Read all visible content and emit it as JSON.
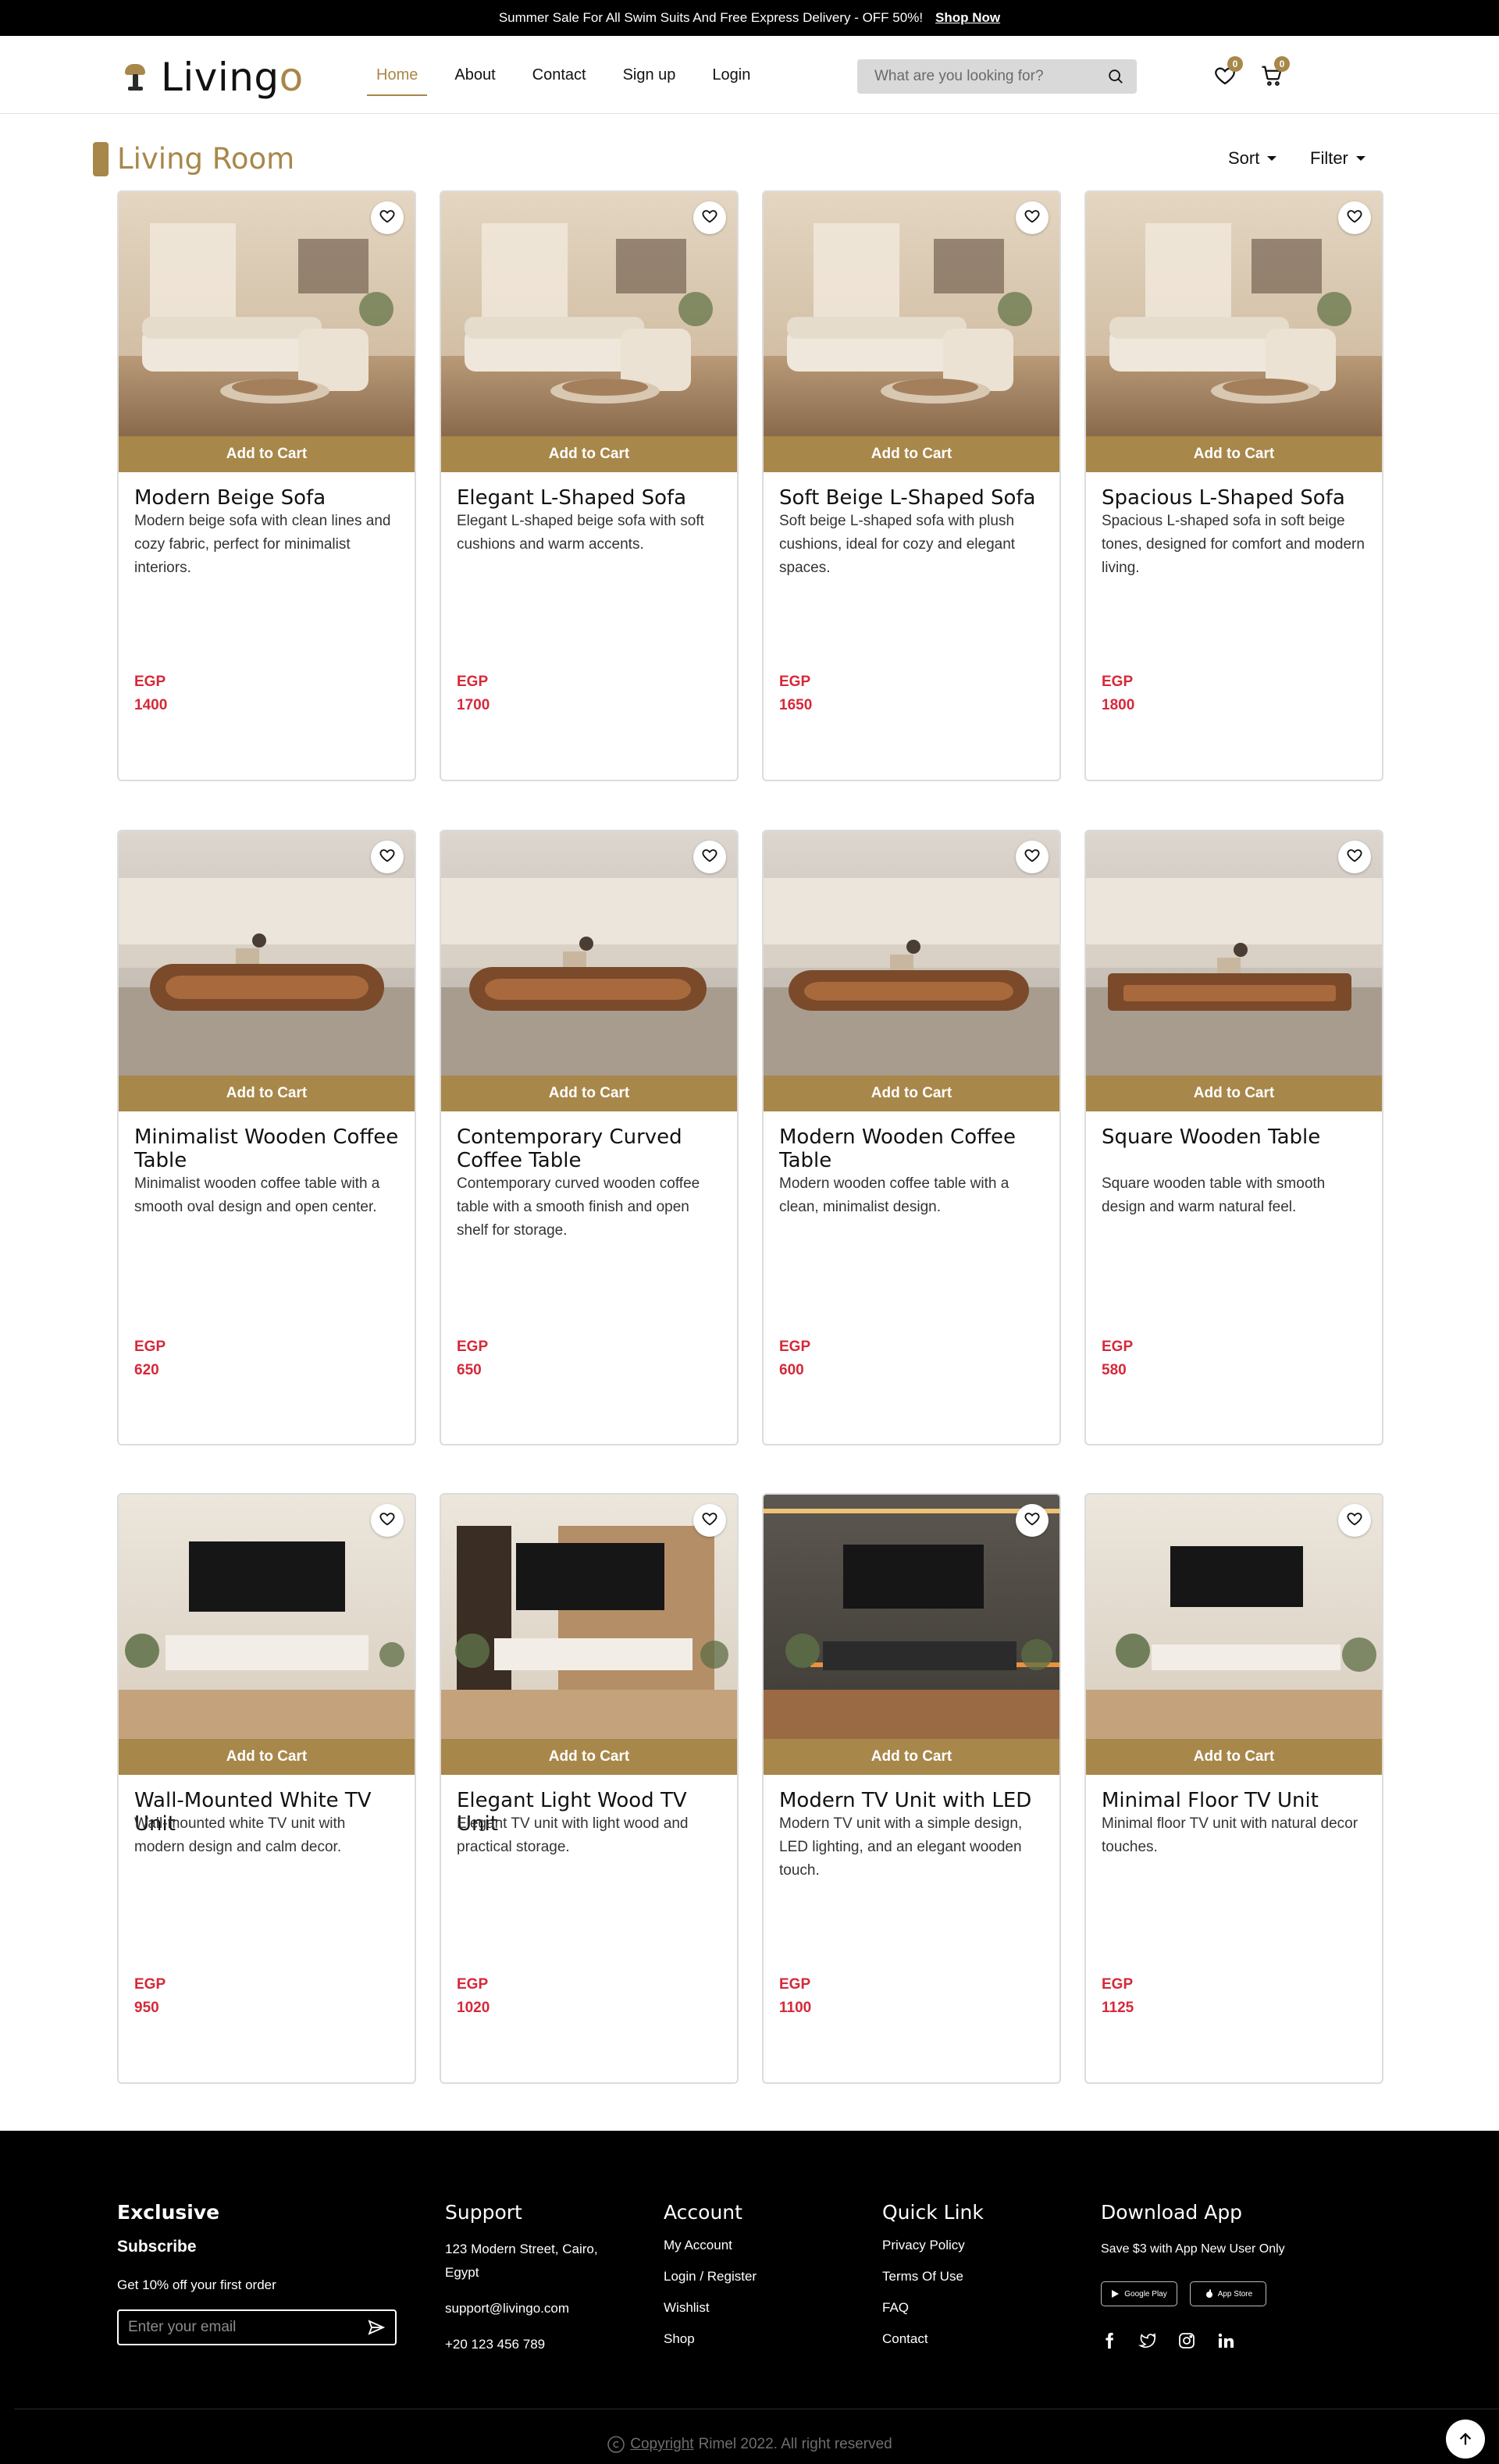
{
  "promo": {
    "text": "Summer Sale For All Swim Suits And Free Express Delivery - OFF 50%!",
    "link": "Shop Now"
  },
  "header": {
    "logo_text": "Living",
    "logo_o": "o",
    "nav": [
      "Home",
      "About",
      "Contact",
      "Sign up",
      "Login"
    ],
    "active_nav": "Home",
    "search_placeholder": "What are you looking for?",
    "wishlist_count": "0",
    "cart_count": "0"
  },
  "page": {
    "title": "Living Room",
    "sort_label": "Sort",
    "filter_label": "Filter"
  },
  "products": [
    {
      "name": "Modern Beige Sofa",
      "desc": "Modern beige sofa with clean lines and cozy fabric, perfect for minimalist interiors.",
      "currency": "EGP",
      "price": "1400",
      "cta": "Add to Cart",
      "scene": "sofa"
    },
    {
      "name": "Elegant L-Shaped Sofa",
      "desc": "Elegant L-shaped beige sofa with soft cushions and warm accents.",
      "currency": "EGP",
      "price": "1700",
      "cta": "Add to Cart",
      "scene": "sofa"
    },
    {
      "name": "Soft Beige L-Shaped Sofa",
      "desc": "Soft beige L-shaped sofa with plush cushions, ideal for cozy and elegant spaces.",
      "currency": "EGP",
      "price": "1650",
      "cta": "Add to Cart",
      "scene": "sofa"
    },
    {
      "name": "Spacious L-Shaped Sofa",
      "desc": "Spacious L-shaped sofa in soft beige tones, designed for comfort and modern living.",
      "currency": "EGP",
      "price": "1800",
      "cta": "Add to Cart",
      "scene": "sofa"
    },
    {
      "name": "Minimalist Wooden Coffee Table",
      "desc": "Minimalist wooden coffee table with a smooth oval design and open center.",
      "currency": "EGP",
      "price": "620",
      "cta": "Add to Cart",
      "scene": "table"
    },
    {
      "name": "Contemporary Curved Coffee Table",
      "desc": "Contemporary curved wooden coffee table with a smooth finish and open shelf for storage.",
      "currency": "EGP",
      "price": "650",
      "cta": "Add to Cart",
      "scene": "table"
    },
    {
      "name": "Modern Wooden Coffee Table",
      "desc": "Modern wooden coffee table with a clean, minimalist design.",
      "currency": "EGP",
      "price": "600",
      "cta": "Add to Cart",
      "scene": "table"
    },
    {
      "name": "Square Wooden Table",
      "desc": "Square wooden table with smooth design and warm natural feel.",
      "currency": "EGP",
      "price": "580",
      "cta": "Add to Cart",
      "scene": "table"
    },
    {
      "name": "Wall-Mounted White TV Unit",
      "desc": "Wall-mounted white TV unit with modern design and calm decor.",
      "currency": "EGP",
      "price": "950",
      "cta": "Add to Cart",
      "scene": "tv"
    },
    {
      "name": "Elegant Light Wood TV Unit",
      "desc": "Elegant TV unit with light wood and practical storage.",
      "currency": "EGP",
      "price": "1020",
      "cta": "Add to Cart",
      "scene": "tv"
    },
    {
      "name": "Modern TV Unit with LED",
      "desc": "Modern TV unit with a simple design, LED lighting, and an elegant wooden touch.",
      "currency": "EGP",
      "price": "1100",
      "cta": "Add to Cart",
      "scene": "tv"
    },
    {
      "name": "Minimal Floor TV Unit",
      "desc": "Minimal floor TV unit with natural decor touches.",
      "currency": "EGP",
      "price": "1125",
      "cta": "Add to Cart",
      "scene": "tv"
    }
  ],
  "footer": {
    "exclusive": {
      "heading": "Exclusive",
      "subscribe": "Subscribe",
      "offer": "Get 10% off your first order",
      "email_placeholder": "Enter your email"
    },
    "support": {
      "heading": "Support",
      "address": "123 Modern Street, Cairo, Egypt",
      "email": "support@livingo.com",
      "phone": "+20 123 456 789"
    },
    "account": {
      "heading": "Account",
      "links": [
        "My Account",
        "Login / Register",
        "Wishlist",
        "Shop"
      ]
    },
    "quick_link": {
      "heading": "Quick Link",
      "links": [
        "Privacy Policy",
        "Terms Of Use",
        "FAQ",
        "Contact"
      ]
    },
    "download": {
      "heading": "Download App",
      "text": "Save $3 with App New User Only",
      "google_play": "Google Play",
      "app_store": "App Store"
    },
    "copyright_link": "Copyright",
    "copyright_text": "Rimel 2022. All right reserved"
  },
  "colors": {
    "accent": "#a8874a",
    "price": "#d62839",
    "footer_bg": "#000000"
  }
}
